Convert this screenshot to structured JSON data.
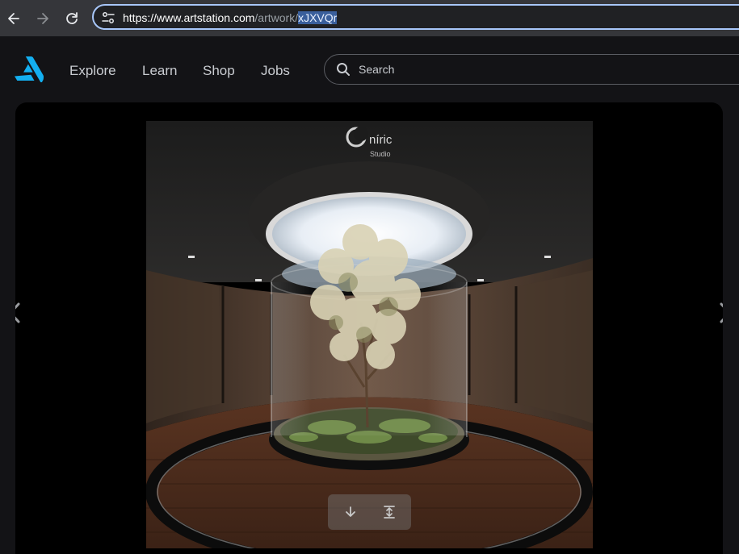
{
  "browser": {
    "url_host": "https://www.artstation.com",
    "url_path": "/artwork/",
    "url_selected": "xJXVQr"
  },
  "header": {
    "nav": [
      "Explore",
      "Learn",
      "Shop",
      "Jobs"
    ],
    "search_placeholder": "Search"
  },
  "artwork": {
    "watermark_brand": "níric",
    "watermark_sub": "Studio"
  },
  "colors": {
    "accent": "#13aff0",
    "url_focus": "#a8c7fa"
  }
}
